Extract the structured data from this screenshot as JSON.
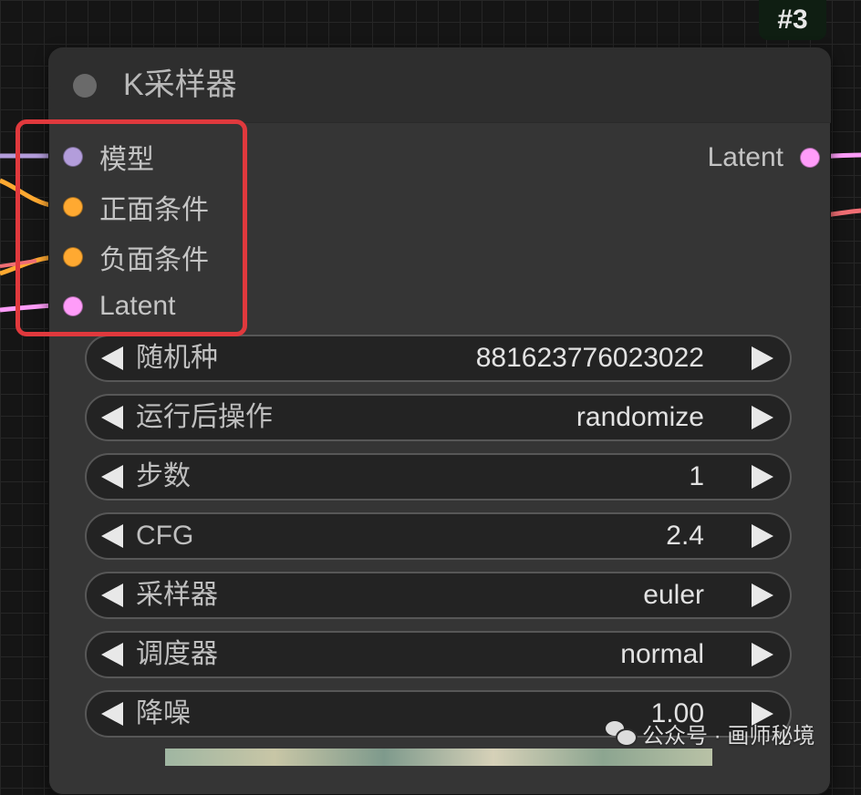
{
  "node": {
    "id_badge": "#3",
    "title": "K采样器",
    "inputs": [
      {
        "label": "模型",
        "color": "#b39ddb"
      },
      {
        "label": "正面条件",
        "color": "#ffa931"
      },
      {
        "label": "负面条件",
        "color": "#ffa931"
      },
      {
        "label": "Latent",
        "color": "#ff9cf9"
      }
    ],
    "output": {
      "label": "Latent",
      "color": "#ff9cf9"
    },
    "widgets": [
      {
        "label": "随机种",
        "value": "881623776023022"
      },
      {
        "label": "运行后操作",
        "value": "randomize"
      },
      {
        "label": "步数",
        "value": "1"
      },
      {
        "label": "CFG",
        "value": "2.4"
      },
      {
        "label": "采样器",
        "value": "euler"
      },
      {
        "label": "调度器",
        "value": "normal"
      },
      {
        "label": "降噪",
        "value": "1.00"
      }
    ]
  },
  "watermark": {
    "text": "公众号 · 画师秘境"
  },
  "colors": {
    "highlight": "#e0393d",
    "model_wire": "#b39ddb",
    "conditioning_wire": "#ffa931",
    "latent_wire": "#ff9cf9",
    "output_red_wire": "#f06e74"
  }
}
